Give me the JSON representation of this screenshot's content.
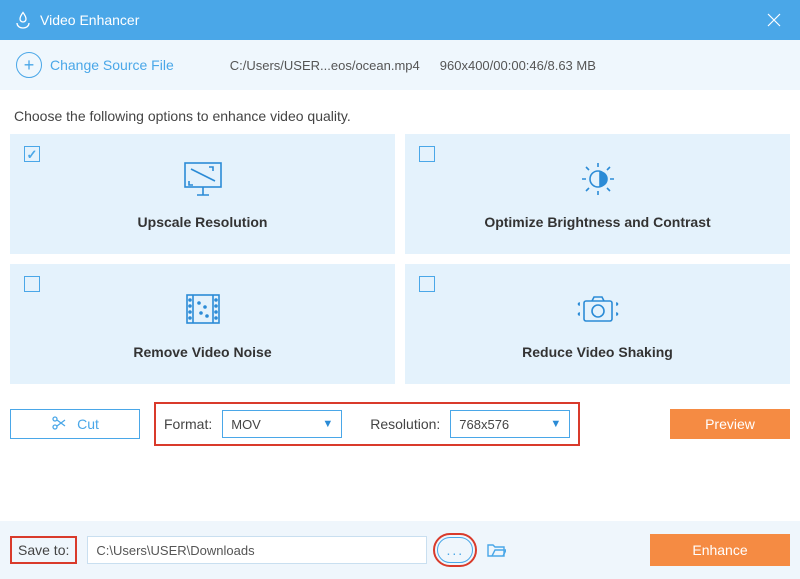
{
  "titlebar": {
    "title": "Video Enhancer"
  },
  "source": {
    "change_label": "Change Source File",
    "path": "C:/Users/USER...eos/ocean.mp4",
    "info": "960x400/00:00:46/8.63 MB"
  },
  "instruction": "Choose the following options to enhance video quality.",
  "options": [
    {
      "key": "upscale",
      "label": "Upscale Resolution",
      "checked": true
    },
    {
      "key": "brightness",
      "label": "Optimize Brightness and Contrast",
      "checked": false
    },
    {
      "key": "noise",
      "label": "Remove Video Noise",
      "checked": false
    },
    {
      "key": "shaking",
      "label": "Reduce Video Shaking",
      "checked": false
    }
  ],
  "controls": {
    "cut_label": "Cut",
    "format_label": "Format:",
    "format_value": "MOV",
    "resolution_label": "Resolution:",
    "resolution_value": "768x576",
    "preview_label": "Preview"
  },
  "save": {
    "label": "Save to:",
    "path": "C:\\Users\\USER\\Downloads",
    "browse": "...",
    "enhance_label": "Enhance"
  }
}
